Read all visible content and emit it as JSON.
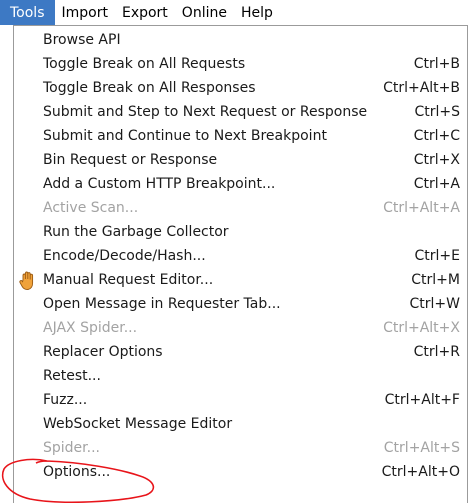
{
  "menubar": {
    "items": [
      {
        "label": "Tools",
        "active": true
      },
      {
        "label": "Import",
        "active": false
      },
      {
        "label": "Export",
        "active": false
      },
      {
        "label": "Online",
        "active": false
      },
      {
        "label": "Help",
        "active": false
      }
    ]
  },
  "dropdown": {
    "items": [
      {
        "label": "Browse API",
        "accel": "",
        "enabled": true
      },
      {
        "label": "Toggle Break on All Requests",
        "accel": "Ctrl+B",
        "enabled": true
      },
      {
        "label": "Toggle Break on All Responses",
        "accel": "Ctrl+Alt+B",
        "enabled": true
      },
      {
        "label": "Submit and Step to Next Request or Response",
        "accel": "Ctrl+S",
        "enabled": true
      },
      {
        "label": "Submit and Continue to Next Breakpoint",
        "accel": "Ctrl+C",
        "enabled": true
      },
      {
        "label": "Bin Request or Response",
        "accel": "Ctrl+X",
        "enabled": true
      },
      {
        "label": "Add a Custom HTTP Breakpoint...",
        "accel": "Ctrl+A",
        "enabled": true
      },
      {
        "label": "Active Scan...",
        "accel": "Ctrl+Alt+A",
        "enabled": false
      },
      {
        "label": "Run the Garbage Collector",
        "accel": "",
        "enabled": true
      },
      {
        "label": "Encode/Decode/Hash...",
        "accel": "Ctrl+E",
        "enabled": true
      },
      {
        "label": "Manual Request Editor...",
        "accel": "Ctrl+M",
        "enabled": true,
        "icon": "hand-icon"
      },
      {
        "label": "Open Message in Requester Tab...",
        "accel": "Ctrl+W",
        "enabled": true
      },
      {
        "label": "AJAX Spider...",
        "accel": "Ctrl+Alt+X",
        "enabled": false
      },
      {
        "label": "Replacer Options",
        "accel": "Ctrl+R",
        "enabled": true
      },
      {
        "label": "Retest...",
        "accel": "",
        "enabled": true
      },
      {
        "label": "Fuzz...",
        "accel": "Ctrl+Alt+F",
        "enabled": true
      },
      {
        "label": "WebSocket Message Editor",
        "accel": "",
        "enabled": true
      },
      {
        "label": "Spider...",
        "accel": "Ctrl+Alt+S",
        "enabled": false
      },
      {
        "label": "Options...",
        "accel": "Ctrl+Alt+O",
        "enabled": true
      }
    ]
  },
  "colors": {
    "menu_highlight": "#3d79c4",
    "annotation_red": "#e8141a",
    "disabled_text": "#a3a3a3"
  }
}
